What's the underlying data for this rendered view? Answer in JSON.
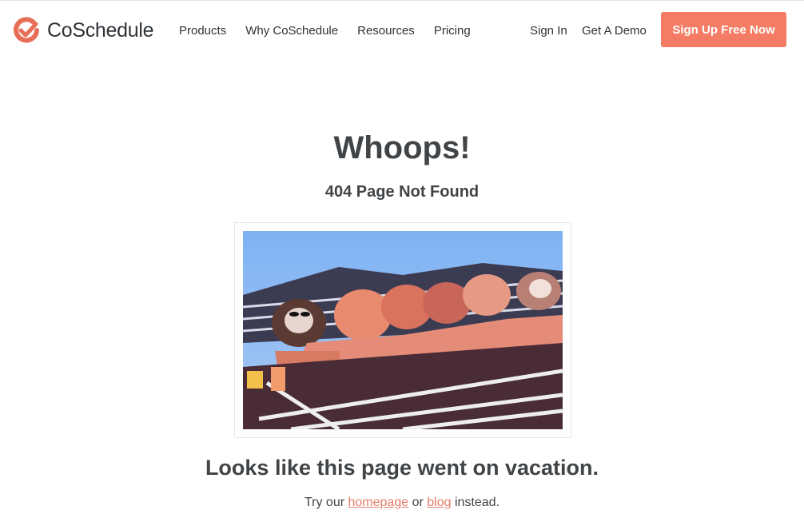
{
  "brand": {
    "name": "CoSchedule",
    "logo_icon": "checkmark-circle-icon",
    "accent_color": "#f47b64"
  },
  "nav": {
    "items": [
      {
        "label": "Products"
      },
      {
        "label": "Why CoSchedule"
      },
      {
        "label": "Resources"
      },
      {
        "label": "Pricing"
      }
    ],
    "sign_in": "Sign In",
    "demo": "Get A Demo",
    "cta": "Sign Up Free Now"
  },
  "main": {
    "title": "Whoops!",
    "subtitle": "404 Page Not Found",
    "tagline": "Looks like this page went on vacation.",
    "help": {
      "prefix": "Try our",
      "homepage_link": "homepage",
      "middle": "or",
      "blog_link": "blog",
      "suffix": "instead."
    }
  }
}
